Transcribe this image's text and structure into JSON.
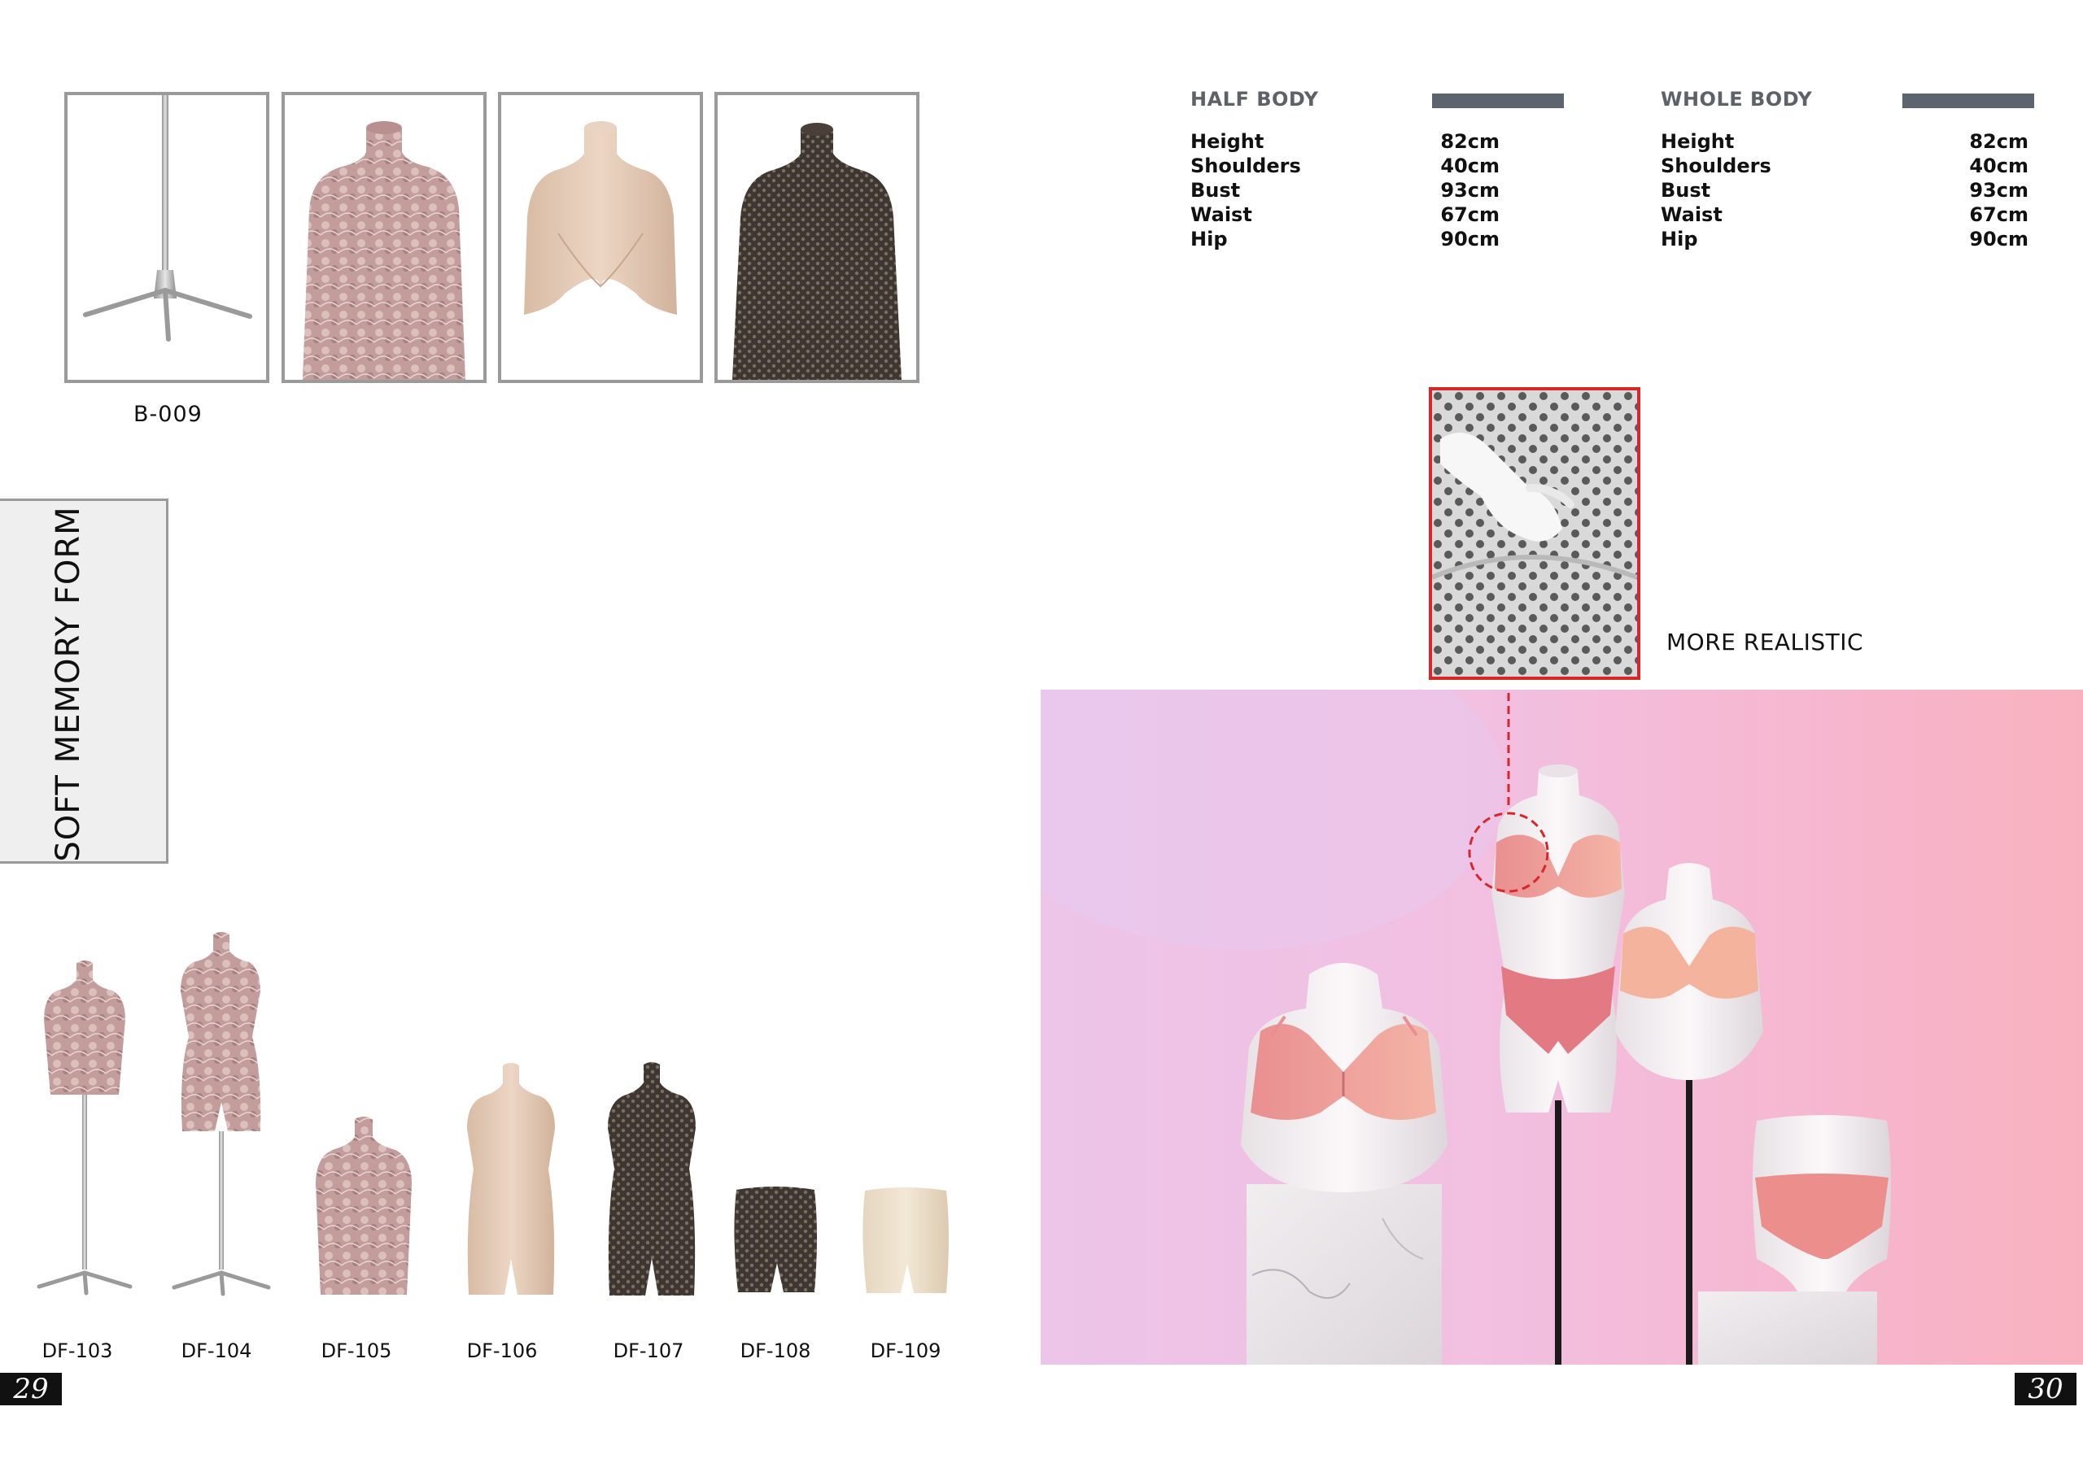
{
  "left_page": {
    "swatches_stand_code": "B-009",
    "side_tab_title": "SOFT MEMORY FORM",
    "figures": [
      {
        "code": "DF-103"
      },
      {
        "code": "DF-104"
      },
      {
        "code": "DF-105"
      },
      {
        "code": "DF-106"
      },
      {
        "code": "DF-107"
      },
      {
        "code": "DF-108"
      },
      {
        "code": "DF-109"
      }
    ],
    "page_number": "29"
  },
  "right_page": {
    "half_body": {
      "title": "HALF BODY",
      "rows": [
        {
          "label": "Height",
          "value": "82cm"
        },
        {
          "label": "Shoulders",
          "value": "40cm"
        },
        {
          "label": "Bust",
          "value": "93cm"
        },
        {
          "label": "Waist",
          "value": "67cm"
        },
        {
          "label": "Hip",
          "value": "90cm"
        }
      ]
    },
    "whole_body": {
      "title": "WHOLE BODY",
      "rows": [
        {
          "label": "Height",
          "value": "82cm"
        },
        {
          "label": "Shoulders",
          "value": "40cm"
        },
        {
          "label": "Bust",
          "value": "93cm"
        },
        {
          "label": "Waist",
          "value": "67cm"
        },
        {
          "label": "Hip",
          "value": "90cm"
        }
      ]
    },
    "callout": "MORE REALISTIC",
    "page_number": "30"
  },
  "colors": {
    "accent_red": "#d8262b",
    "bar_gray": "#5c6470",
    "title_gray": "#5c6268",
    "lace_pink": "#c9a3a3",
    "skin_tone": "#e4cbb6",
    "mesh_brown": "#5b5048",
    "photo_pink": "#f2bfe0"
  }
}
